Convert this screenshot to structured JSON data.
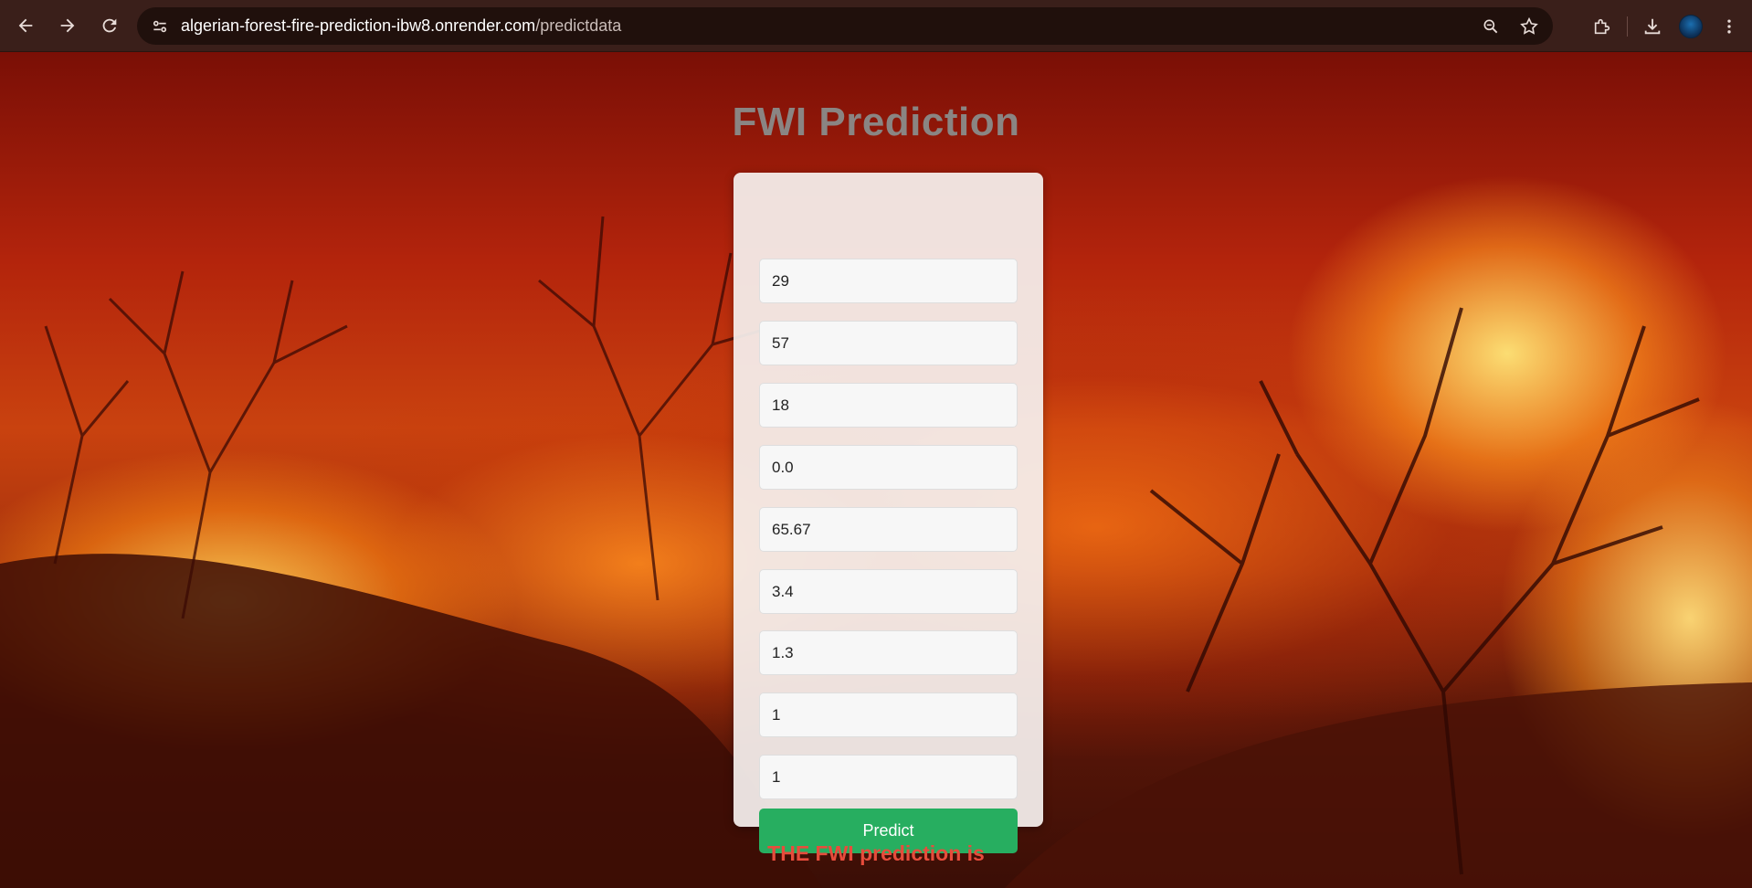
{
  "browser": {
    "url_host": "algerian-forest-fire-prediction-ibw8.onrender.com",
    "url_path": "/predictdata",
    "icons": {
      "back": "arrow-left-icon",
      "forward": "arrow-right-icon",
      "reload": "reload-icon",
      "site_info": "site-settings-icon",
      "zoom": "zoom-icon",
      "bookmark": "star-icon",
      "extensions": "puzzle-icon",
      "downloads": "download-icon",
      "profile": "avatar",
      "menu": "kebab-menu-icon"
    }
  },
  "page": {
    "title": "FWI Prediction",
    "fields": [
      "29",
      "57",
      "18",
      "0.0",
      "65.67",
      "3.4",
      "1.3",
      "1",
      "1"
    ],
    "predict_label": "Predict",
    "result_text": "THE FWI prediction is"
  },
  "colors": {
    "accent_button": "#27ae60",
    "result_text": "#e74c3c",
    "title_text": "#8a8583"
  }
}
